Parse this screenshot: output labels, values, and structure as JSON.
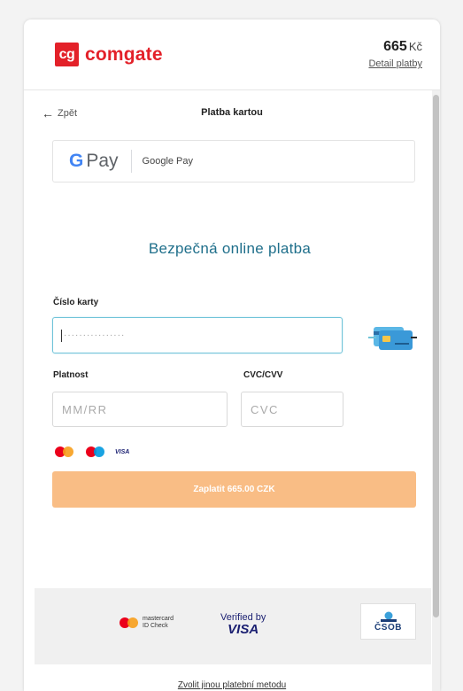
{
  "header": {
    "logo_mark": "cg",
    "logo_text": "comgate",
    "amount": "665",
    "currency": "Kč",
    "detail_link": "Detail platby"
  },
  "nav": {
    "back_label": "Zpět",
    "title": "Platba kartou"
  },
  "google_pay": {
    "logo_g": "G",
    "logo_pay": "Pay",
    "label": "Google Pay"
  },
  "form": {
    "heading": "Bezpečná online platba",
    "card_number_label": "Číslo karty",
    "card_number_value": "················",
    "expiry_label": "Platnost",
    "expiry_placeholder": "MM/RR",
    "cvc_label": "CVC/CVV",
    "cvc_placeholder": "CVC",
    "brand_visa": "VISA",
    "pay_button": "Zaplatit 665.00 CZK"
  },
  "footer": {
    "mc_line1": "mastercard",
    "mc_line2": "ID Check",
    "verified_by": "Verified by",
    "verified_visa": "VISA",
    "csob": "ČSOB",
    "other_method": "Zvolit jinou platební metodu"
  },
  "colors": {
    "brand_red": "#e32129",
    "heading_teal": "#1f6f8b",
    "pay_button": "#f9bd85",
    "input_focus": "#6fc3d8"
  },
  "icons": [
    "back-arrow-icon",
    "credit-card-icon",
    "mastercard-icon",
    "maestro-icon",
    "visa-icon",
    "csob-logo-icon"
  ]
}
